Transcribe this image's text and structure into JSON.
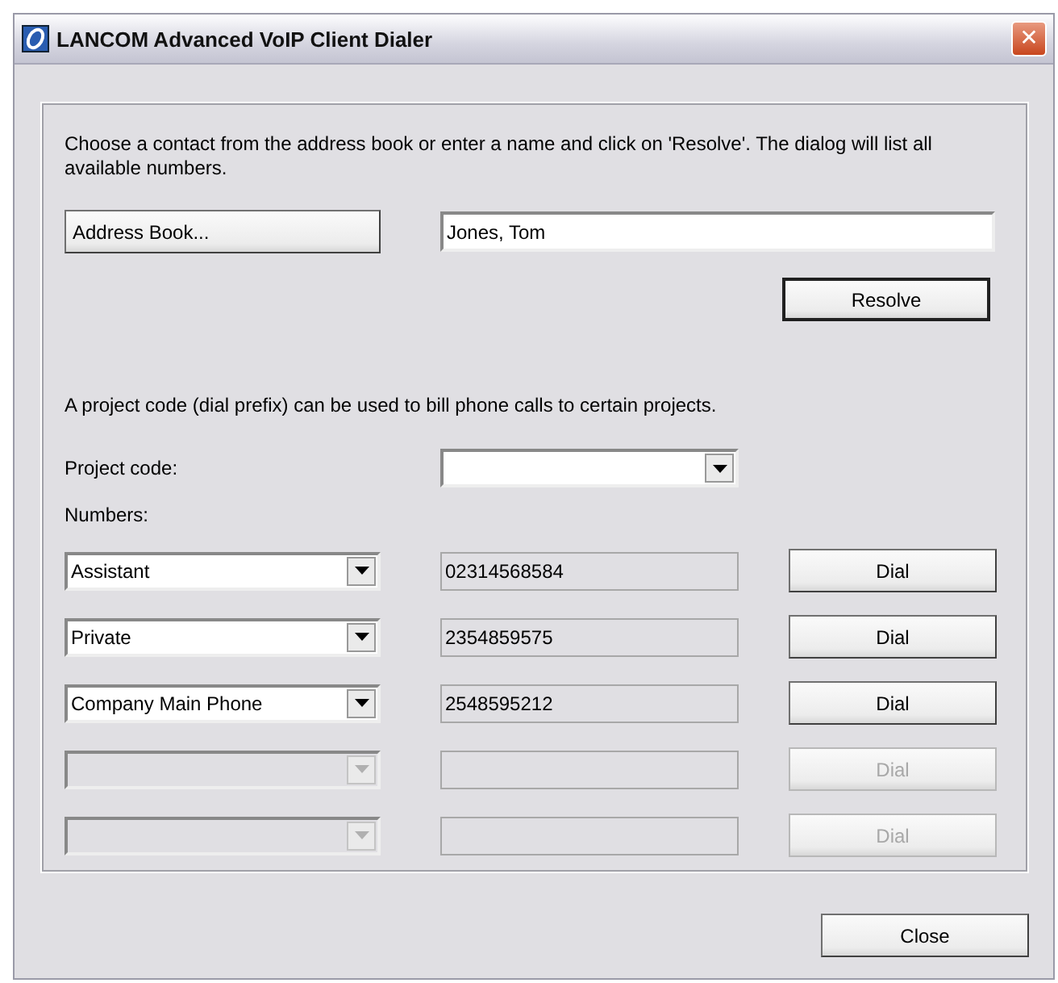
{
  "window": {
    "title": "LANCOM Advanced VoIP Client Dialer",
    "close": "✕"
  },
  "intro": "Choose a contact from the address book or enter a name and click on 'Resolve'. The dialog will list all available numbers.",
  "address_book_button": "Address Book...",
  "name_field": {
    "value": "Jones, Tom"
  },
  "resolve_button": "Resolve",
  "project_note": "A project code (dial prefix) can be used to bill phone calls to certain projects.",
  "project_code": {
    "label": "Project code:"
  },
  "numbers_label": "Numbers:",
  "numbers": [
    {
      "type": "Assistant",
      "number": "02314568584",
      "dial": "Dial",
      "disabled": false
    },
    {
      "type": "Private",
      "number": "2354859575",
      "dial": "Dial",
      "disabled": false
    },
    {
      "type": "Company Main Phone",
      "number": "2548595212",
      "dial": "Dial",
      "disabled": false
    },
    {
      "dial": "Dial",
      "disabled": true
    },
    {
      "dial": "Dial",
      "disabled": true
    }
  ],
  "close_button": "Close"
}
